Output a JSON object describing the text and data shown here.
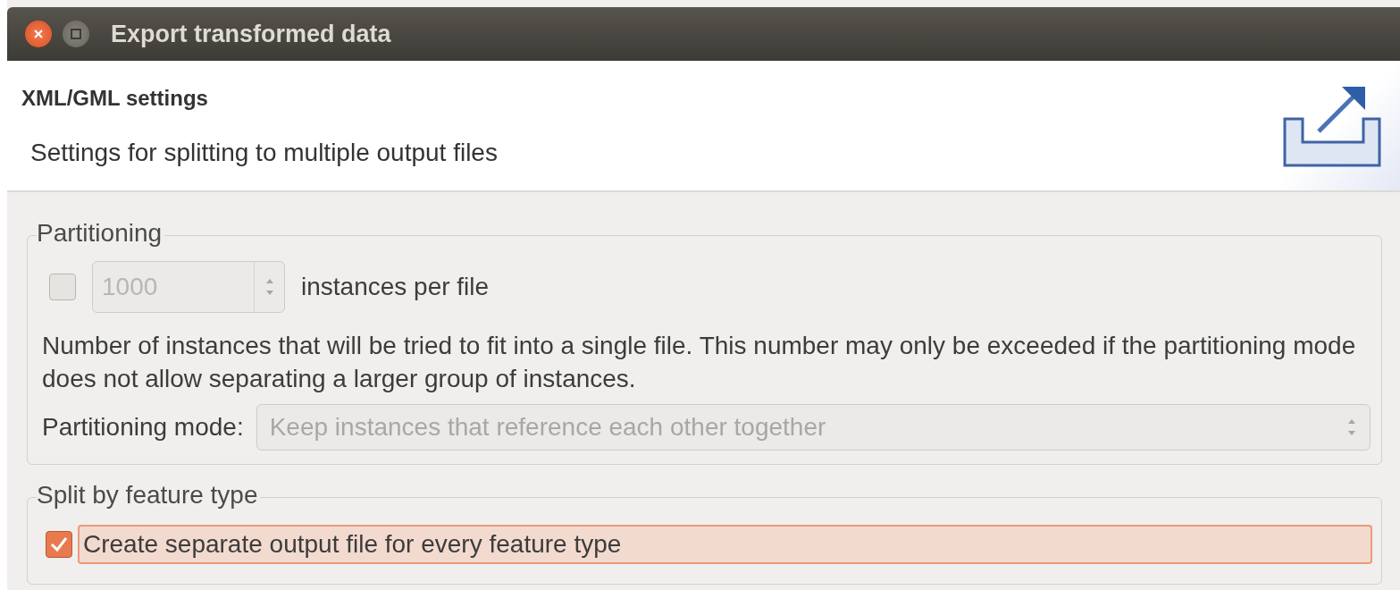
{
  "window": {
    "title": "Export transformed data"
  },
  "header": {
    "title": "XML/GML settings",
    "subtitle": "Settings for splitting to multiple output files"
  },
  "partitioning": {
    "legend": "Partitioning",
    "limit_checkbox": {
      "checked": false
    },
    "spinner": {
      "value": "1000",
      "disabled": true
    },
    "unit_label": "instances per file",
    "description": "Number of instances that will be tried to fit into a single file. This number may only be exceeded if the partitioning mode does not allow separating a larger group of instances.",
    "mode_label": "Partitioning mode:",
    "mode_select": {
      "value": "Keep instances that reference each other together",
      "disabled": true
    }
  },
  "split": {
    "legend": "Split by feature type",
    "checkbox": {
      "label": "Create separate output file for every feature type",
      "checked": true,
      "focused": true
    }
  }
}
